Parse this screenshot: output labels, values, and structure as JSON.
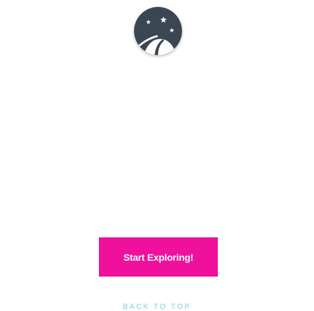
{
  "logo": {
    "icon": "night-sky-observatory-icon",
    "background_color": "#3a4652"
  },
  "cta": {
    "label": "Start Exploring!",
    "color": "#f0109e"
  },
  "footer": {
    "back_to_top_label": "BACK TO TOP",
    "link_color": "#7fd3e6"
  }
}
